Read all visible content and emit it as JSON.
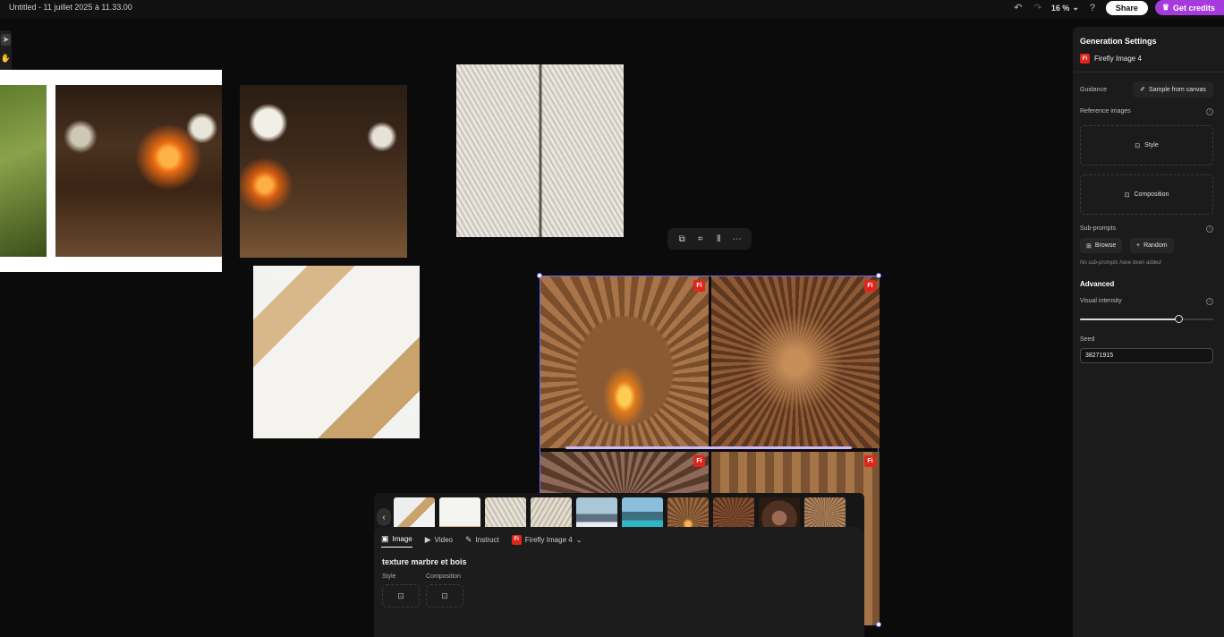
{
  "header": {
    "doc_title": "Untitled - 11 juillet 2025 à 11.33.00",
    "zoom": "16 %",
    "share_label": "Share",
    "credits_label": "Get credits"
  },
  "toolbar": {
    "tools": [
      "select-icon",
      "hand-icon",
      "text-icon",
      "shape-icon",
      "brush-icon"
    ]
  },
  "canvas": {
    "float_toolbar": [
      "crop-icon",
      "qr-icon",
      "align-icon",
      "more-icon"
    ],
    "tile_badge": "Fi"
  },
  "thumbnails": {
    "prev": "‹"
  },
  "prompt": {
    "tabs": [
      {
        "label": "Image",
        "icon": "image-icon"
      },
      {
        "label": "Video",
        "icon": "video-icon"
      },
      {
        "label": "Instruct",
        "icon": "instruct-icon"
      }
    ],
    "model": "Firefly Image 4",
    "model_badge": "Fi",
    "text": "texture marbre et bois",
    "style_label": "Style",
    "composition_label": "Composition"
  },
  "panel": {
    "title": "Generation Settings",
    "model": "Firefly Image 4",
    "model_badge": "Fi",
    "guidance_label": "Guidance",
    "sample_label": "Sample from canvas",
    "reference_label": "Reference images",
    "style_label": "Style",
    "composition_label": "Composition",
    "subprompts_label": "Sub-prompts",
    "browse_label": "Browse",
    "random_label": "Random",
    "subprompts_note": "No sub-prompts have been added",
    "advanced_label": "Advanced",
    "intensity_label": "Visual intensity",
    "intensity_value": 0.74,
    "seed_label": "Seed",
    "seed_value": "38271915"
  }
}
